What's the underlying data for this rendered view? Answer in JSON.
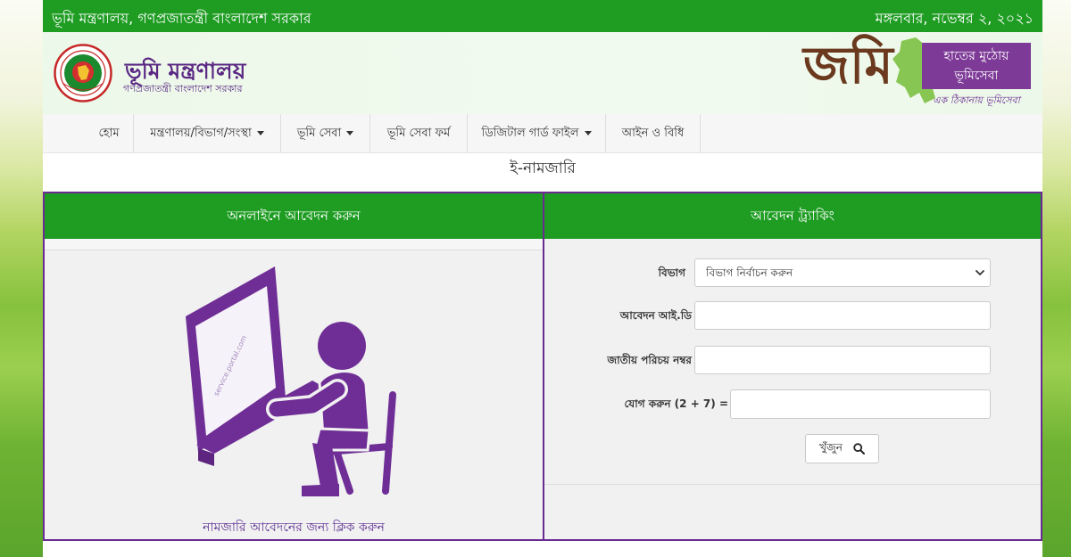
{
  "colors": {
    "accent_green": "#1f9d23",
    "brand_purple": "#6a2a93",
    "brand_brown": "#6b3a1e",
    "map_green": "#7cc043"
  },
  "topbar": {
    "ministry_line": "ভূমি মন্ত্রণালয়, গণপ্রজাতন্ত্রী বাংলাদেশ সরকার",
    "date": "মঙ্গলবার, নভেম্বর ২, ২০২১"
  },
  "header": {
    "logo_icon": "government-seal-icon",
    "title": "ভূমি মন্ত্রণালয়",
    "subtitle": "গণপ্রজাতন্ত্রী বাংলাদেশ সরকার",
    "brand": {
      "logo_text": "জমি",
      "map_icon": "bangladesh-map-icon",
      "tagline_line1": "হাতের মুঠোয়",
      "tagline_line2": "ভূমিসেবা",
      "slogan": "এক ঠিকানায় ভূমিসেবা"
    }
  },
  "nav": {
    "dropdown_icon": "caret-down-icon",
    "items": [
      {
        "label": "হোম",
        "has_dropdown": false
      },
      {
        "label": "মন্ত্রণালয়/বিভাগ/সংস্থা",
        "has_dropdown": true
      },
      {
        "label": "ভূমি সেবা",
        "has_dropdown": true
      },
      {
        "label": "ভূমি সেবা ফর্ম",
        "has_dropdown": false
      },
      {
        "label": "ডিজিটাল গার্ড ফাইল",
        "has_dropdown": true
      },
      {
        "label": "আইন ও বিধি",
        "has_dropdown": false
      }
    ]
  },
  "page_title": "ই-নামজারি",
  "apply_panel": {
    "heading": "অনলাইনে আবেদন করুন",
    "illustration_icon": "person-at-computer-icon",
    "screen_text": "service.portal.com",
    "link_label": "নামজারি আবেদনের জন্য ক্লিক করুন"
  },
  "tracking_panel": {
    "heading": "আবেদন ট্র্যাকিং",
    "fields": {
      "division": {
        "label": "বিভাগ",
        "selected": "বিভাগ নির্বাচন করুন"
      },
      "application_id": {
        "label": "আবেদন আই.ডি",
        "value": ""
      },
      "nid": {
        "label": "জাতীয় পরিচয় নম্বর",
        "value": ""
      },
      "captcha": {
        "label": "যোগ করুন (2 + 7) =",
        "value": ""
      }
    },
    "search_button": {
      "label": "খুঁজুন",
      "icon": "search-icon"
    }
  }
}
